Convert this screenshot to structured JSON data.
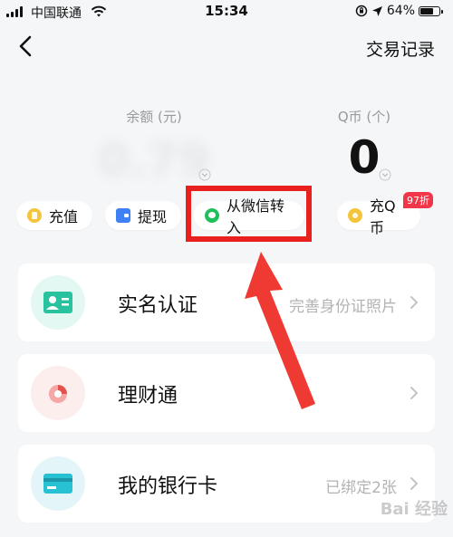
{
  "status_bar": {
    "carrier": "中国联通",
    "time": "15:34",
    "battery": "64%"
  },
  "nav": {
    "title": "交易记录"
  },
  "balance": {
    "label": "余额 (元)",
    "value": "0.79"
  },
  "qcoin": {
    "label": "Q币 (个)",
    "value": "0"
  },
  "actions": {
    "recharge": "充值",
    "withdraw": "提现",
    "wechat_transfer": "从微信转入",
    "recharge_qcoin": "充Q币",
    "discount_badge": "97折"
  },
  "list": {
    "items": [
      {
        "label": "实名认证",
        "info": "完善身份证照片"
      },
      {
        "label": "理财通",
        "info": ""
      },
      {
        "label": "我的银行卡",
        "info": "已绑定2张"
      }
    ]
  },
  "watermark": "Bai 经验",
  "colors": {
    "highlight": "#e8211e",
    "arrow": "#ef3a33",
    "badge": "#f2364a",
    "gold": "#f4c53c",
    "wechat_green": "#1fbf5b"
  }
}
